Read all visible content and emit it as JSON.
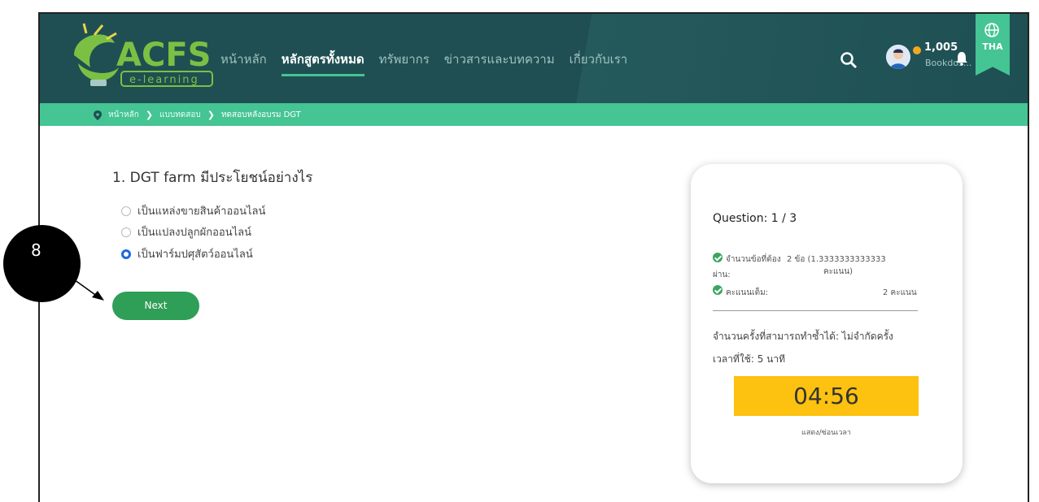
{
  "header": {
    "logo_text": "ACFS",
    "logo_sub": "e-learning",
    "nav": [
      {
        "label": "หน้าหลัก",
        "active": false
      },
      {
        "label": "หลักสูตรทั้งหมด",
        "active": true
      },
      {
        "label": "ทรัพยากร",
        "active": false
      },
      {
        "label": "ข่าวสารและบทความ",
        "active": false
      },
      {
        "label": "เกี่ยวกับเรา",
        "active": false
      }
    ],
    "points": "1,005",
    "username": "Bookdos...",
    "lang": "THA"
  },
  "breadcrumb": {
    "items": [
      "หน้าหลัก",
      "แบบทดสอบ",
      "ทดสอบหลังอบรม DGT"
    ]
  },
  "quiz": {
    "question": "1. DGT farm มีประโยชน์อย่างไร",
    "options": [
      {
        "label": "เป็นแหล่งขายสินค้าออนไลน์",
        "selected": false
      },
      {
        "label": "เป็นแปลงปลูกผักออนไลน์",
        "selected": false
      },
      {
        "label": "เป็นฟาร์มปศุสัตว์ออนไลน์",
        "selected": true
      }
    ],
    "next_label": "Next"
  },
  "card": {
    "question_progress": "Question: 1 / 3",
    "pass_label": "จำนวนข้อที่ต้อง",
    "pass_label2": "ผ่าน:",
    "pass_value": "2 ข้อ (1.3333333333333",
    "pass_value2": "คะแนน)",
    "full_label": "คะแนนเต็ม:",
    "full_value": "2 คะแนน",
    "attempts": "จำนวนครั้งที่สามารถทำซ้ำได้: ไม่จำกัดครั้ง",
    "time_used": "เวลาที่ใช้: 5 นาที",
    "timer": "04:56",
    "toggle_label": "แสดง/ซ่อนเวลา"
  },
  "annotation": {
    "step": "8"
  },
  "colors": {
    "header_bg": "#1f4f52",
    "accent_green": "#45c494",
    "button_green": "#2f9e57",
    "timer_yellow": "#fdc20f"
  }
}
